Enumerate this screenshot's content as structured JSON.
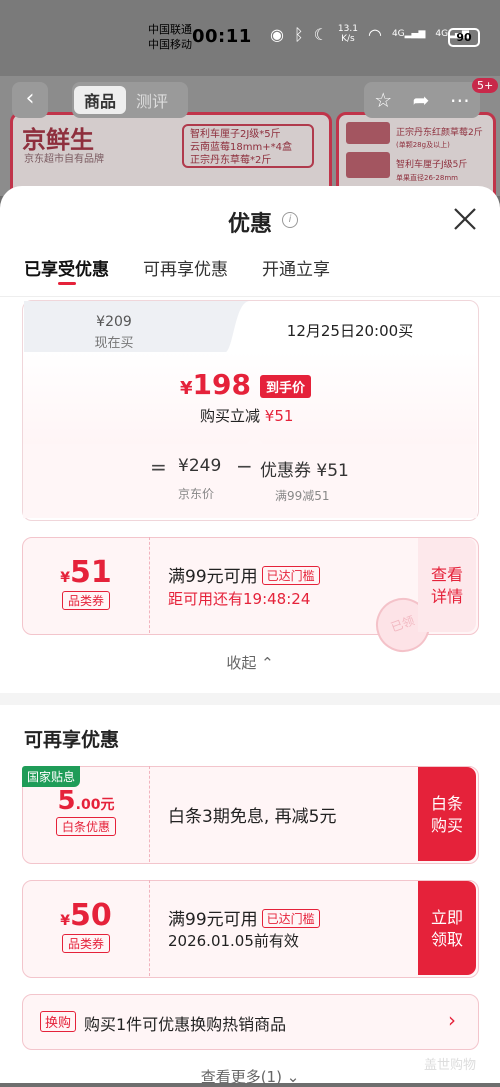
{
  "status_bar": {
    "carrier1": "中国联通",
    "carrier2": "中国移动",
    "time": "00:11",
    "speed_value": "13.1",
    "speed_unit": "K/s",
    "net1": "4G",
    "net2": "4G",
    "battery": "90"
  },
  "bg_page": {
    "tabs": [
      "商品",
      "测评"
    ],
    "cart_badge": "5+",
    "brand": "京鲜生",
    "brand_sub": "京东超市自有品牌",
    "promo_lines": [
      "智利车厘子2J级*5斤",
      "云南蓝莓18mm+*4盒",
      "正宗丹东草莓*2斤"
    ],
    "right_lines": [
      "正宗丹东红颜草莓2斤",
      "(单颗28g及以上)",
      "智利车厘子J级5斤",
      "单果直径26-28mm"
    ]
  },
  "sheet": {
    "title": "优惠",
    "tabs": [
      {
        "label": "已享受优惠"
      },
      {
        "label": "可再享优惠"
      },
      {
        "label": "开通立享"
      }
    ]
  },
  "price_card": {
    "now_price": "¥209",
    "now_label": "现在买",
    "future_time": "12月25日20:00买",
    "final_currency": "¥",
    "final_amount": "198",
    "final_tag": "到手价",
    "reduce_label": "购买立减",
    "reduce_amount": "¥51",
    "eq": "=",
    "jd_price": "¥249",
    "jd_label": "京东价",
    "minus": "−",
    "coupon_part": "优惠券 ¥51",
    "coupon_rule": "满99减51"
  },
  "coupon_used": {
    "currency": "¥",
    "amount": "51",
    "type": "品类券",
    "main": "满99元可用",
    "pill": "已达门槛",
    "countdown": "距可用还有19:48:24",
    "action1": "查看",
    "action2": "详情",
    "stamp": "已领"
  },
  "collapse_label": "收起 ⌃",
  "more_section": {
    "title": "可再享优惠",
    "baitiao": {
      "tag": "国家贴息",
      "amount": "5",
      "decimal": ".00元",
      "type": "白条优惠",
      "main": "白条3期免息, 再减5元",
      "action1": "白条",
      "action2": "购买"
    },
    "coupon50": {
      "currency": "¥",
      "amount": "50",
      "type": "品类券",
      "main": "满99元可用",
      "pill": "已达门槛",
      "valid": "2026.01.05前有效",
      "action1": "立即",
      "action2": "领取"
    },
    "swap": {
      "tag": "换购",
      "text": "购买1件可优惠换购热销商品",
      "arrow": "›"
    },
    "view_more": "查看更多(1) ⌄"
  },
  "watermark": "盖世购物",
  "colors": {
    "accent": "#e5223a",
    "green_tag": "#1f9c58"
  }
}
